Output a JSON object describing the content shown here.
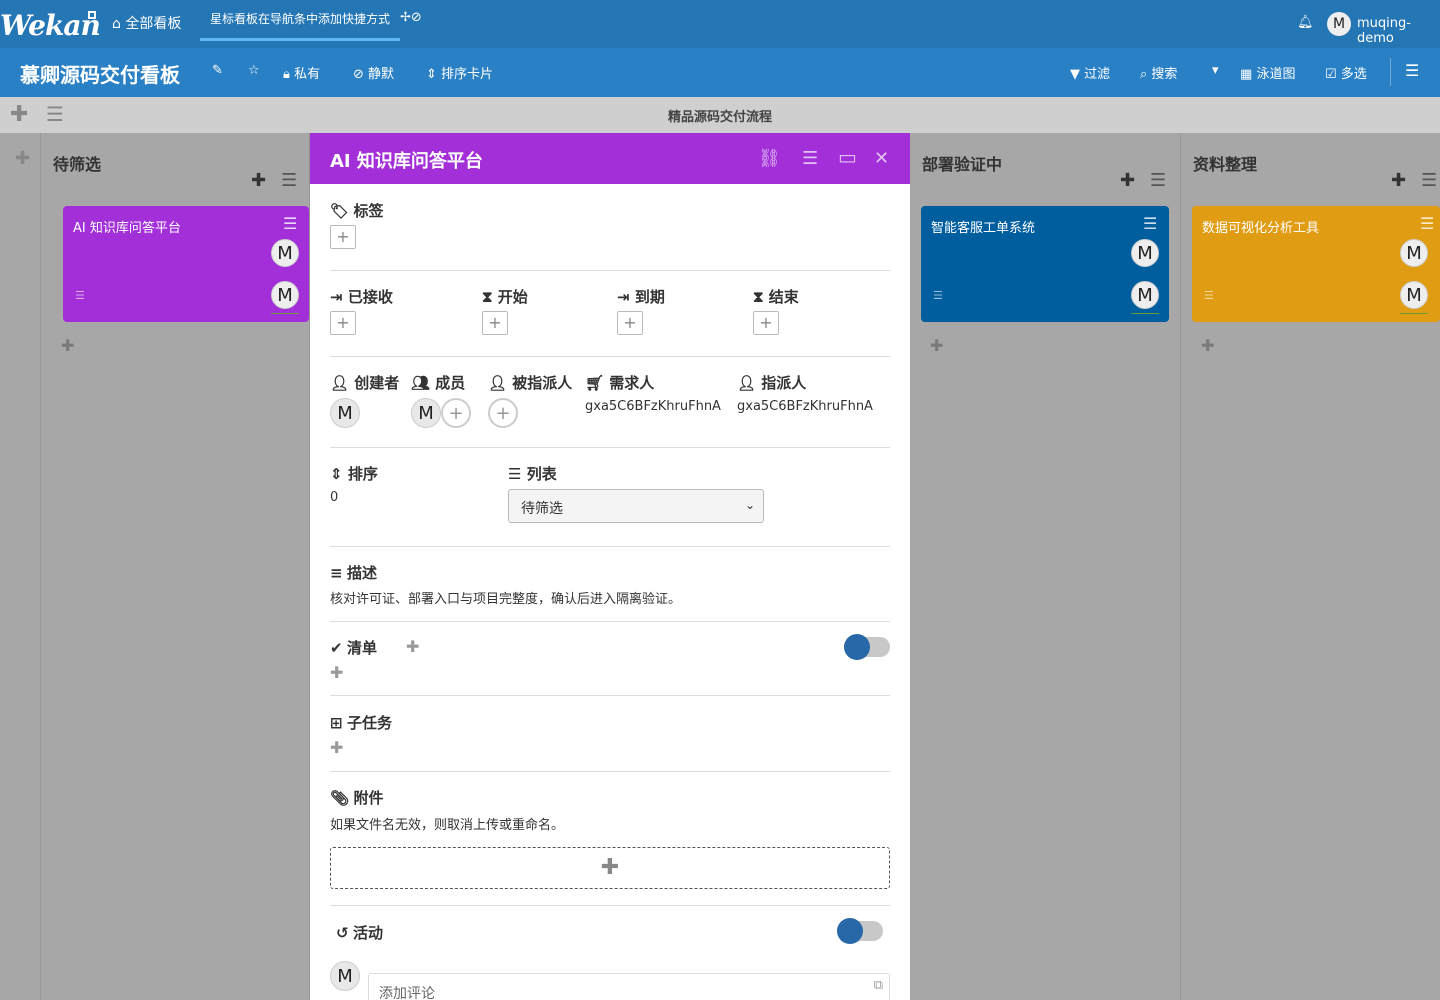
{
  "topbar": {
    "logo": "Wekan",
    "home_label": "全部看板",
    "home_icon": "home-icon",
    "starred_hint": "星标看板在导航条中添加快捷方式",
    "hint_icons": "✢⊘",
    "user_initial": "M",
    "username": "muqing-demo"
  },
  "boardbar": {
    "title": "慕卿源码交付看板",
    "private_label": "私有",
    "mute_label": "静默",
    "sort_label": "排序卡片",
    "filter_label": "过滤",
    "search_label": "搜索",
    "view_label": "泳道图",
    "multiselect_label": "多选"
  },
  "swimlane": {
    "title": "精品源码交付流程"
  },
  "lists": [
    {
      "title": "待筛选",
      "card": {
        "title": "AI 知识库问答平台",
        "color": "#a22fd8",
        "avatar": "M"
      }
    },
    {
      "title": "部署验证中",
      "card": {
        "title": "智能客服工单系统",
        "color": "#005d9e",
        "avatar": "M"
      }
    },
    {
      "title": "资料整理",
      "card": {
        "title": "数据可视化分析工具",
        "color": "#e09d13",
        "avatar": "M"
      }
    }
  ],
  "modal": {
    "title": "AI 知识库问答平台",
    "labels_heading": "标签",
    "dates": [
      {
        "label": "已接收",
        "icon": "sign-in-icon"
      },
      {
        "label": "开始",
        "icon": "hourglass-start-icon"
      },
      {
        "label": "到期",
        "icon": "sign-in-arrow-icon"
      },
      {
        "label": "结束",
        "icon": "hourglass-end-icon"
      }
    ],
    "people": {
      "creator_label": "创建者",
      "members_label": "成员",
      "assignees_label": "被指派人",
      "requester_label": "需求人",
      "requester_value": "gxa5C6BFzKhruFhnA",
      "assigner_label": "指派人",
      "assigner_value": "gxa5C6BFzKhruFhnA",
      "avatar": "M"
    },
    "sort_label": "排序",
    "sort_value": "0",
    "list_label": "列表",
    "list_value": "待筛选",
    "description_label": "描述",
    "description_text": "核对许可证、部署入口与项目完整度，确认后进入隔离验证。",
    "checklist_label": "清单",
    "subtasks_label": "子任务",
    "attachments_label": "附件",
    "attachments_hint": "如果文件名无效，则取消上传或重命名。",
    "activity_label": "活动",
    "comment_placeholder": "添加评论"
  },
  "colors": {
    "topbar": "#2476b5",
    "boardbar": "#2980c5",
    "card_header": "#a22fd8",
    "toggle_knob": "#2868a8"
  }
}
